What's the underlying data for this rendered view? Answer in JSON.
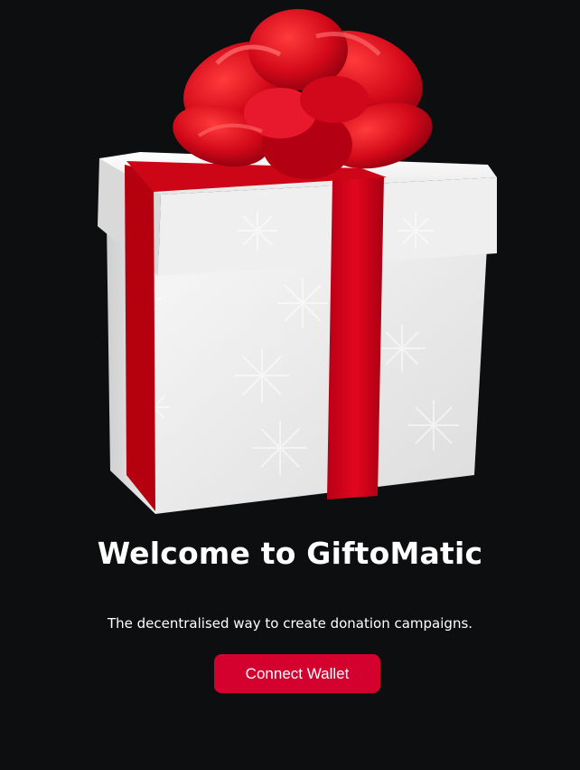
{
  "hero": {
    "illustration": "gift-box-illustration",
    "title": "Welcome to GiftoMatic",
    "subtitle": "The decentralised way to create donation campaigns."
  },
  "actions": {
    "connect_wallet_label": "Connect Wallet"
  },
  "colors": {
    "background": "#0d0e10",
    "accent": "#d4002e",
    "ribbon": "#d0021b",
    "box": "#f2f2f2"
  }
}
